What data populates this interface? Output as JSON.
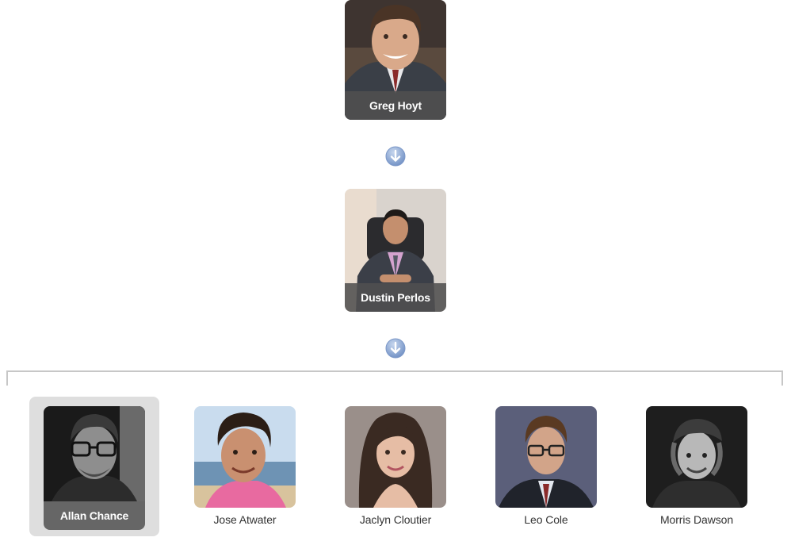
{
  "chain": [
    {
      "name": "Greg Hoyt"
    },
    {
      "name": "Dustin Perlos"
    }
  ],
  "children": [
    {
      "name": "Allan Chance",
      "selected": true
    },
    {
      "name": "Jose Atwater"
    },
    {
      "name": "Jaclyn Cloutier"
    },
    {
      "name": "Leo Cole"
    },
    {
      "name": "Morris Dawson"
    }
  ],
  "colors": {
    "name_bar": "#595959",
    "arrow": "#7f9fcf",
    "connector": "#c7c7c7",
    "selection_bg": "#dedede"
  },
  "icons": {
    "connector_arrow": "arrow-down-circle-icon"
  }
}
